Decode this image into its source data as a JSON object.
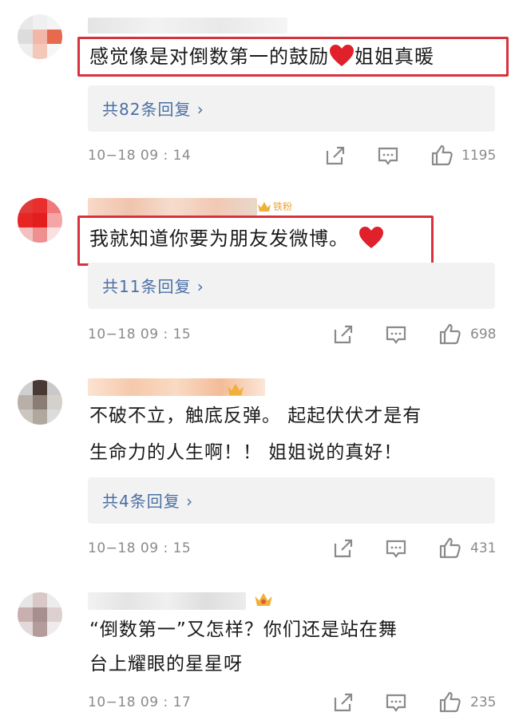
{
  "comments": [
    {
      "text": "感觉像是对倒数第一的鼓励",
      "text_after_heart": "姐姐真暖",
      "replies_label": "共82条回复 ›",
      "time": "10−18 09 : 14",
      "likes": "1195"
    },
    {
      "badge": "铁粉",
      "text": "我就知道你要为朋友发微博。",
      "replies_label": "共11条回复 ›",
      "time": "10−18 09 : 15",
      "likes": "698"
    },
    {
      "text_line1": "不破不立，触底反弹。 起起伏伏才是有",
      "text_line2": "生命力的人生啊！！ 姐姐说的真好！",
      "replies_label": "共4条回复 ›",
      "time": "10−18 09 : 15",
      "likes": "431"
    },
    {
      "text_line1": "“倒数第一”又怎样？你们还是站在舞",
      "text_line2": "台上耀眼的星星呀",
      "time": "10−18 09 : 17",
      "likes": "235"
    }
  ],
  "colors": {
    "highlight_box": "#d8323c",
    "heart": "#e0202a",
    "reply_link": "#4a6fa5",
    "meta": "#8a8a8a"
  },
  "icons": [
    "share-icon",
    "comment-icon",
    "like-icon",
    "heart-icon",
    "crown-icon"
  ]
}
